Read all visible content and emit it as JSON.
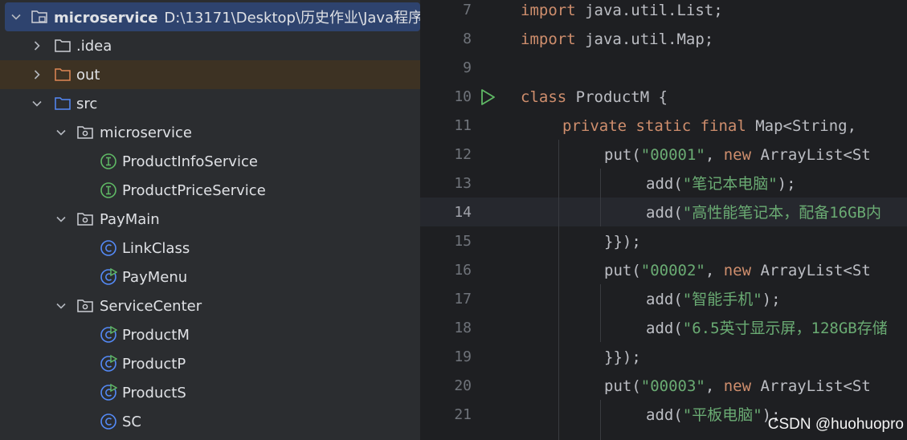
{
  "project_tree": {
    "root": {
      "name": "microservice",
      "path": "D:\\13171\\Desktop\\历史作业\\Java程序设"
    },
    "items": [
      {
        "label": ".idea",
        "type": "folder"
      },
      {
        "label": "out",
        "type": "folder-orange"
      },
      {
        "label": "src",
        "type": "folder-src"
      },
      {
        "label": "microservice",
        "type": "package"
      },
      {
        "label": "ProductInfoService",
        "type": "interface"
      },
      {
        "label": "ProductPriceService",
        "type": "interface"
      },
      {
        "label": "PayMain",
        "type": "package"
      },
      {
        "label": "LinkClass",
        "type": "class"
      },
      {
        "label": "PayMenu",
        "type": "runnable-class"
      },
      {
        "label": "ServiceCenter",
        "type": "package"
      },
      {
        "label": "ProductM",
        "type": "runnable-class"
      },
      {
        "label": "ProductP",
        "type": "runnable-class"
      },
      {
        "label": "ProductS",
        "type": "runnable-class"
      },
      {
        "label": "SC",
        "type": "class"
      }
    ]
  },
  "editor": {
    "line_numbers": [
      "7",
      "8",
      "9",
      "10",
      "11",
      "12",
      "13",
      "14",
      "15",
      "16",
      "17",
      "18",
      "19",
      "20",
      "21"
    ],
    "active_line": "14",
    "lines": {
      "l7": {
        "kw": "import",
        "rest": " java.util.List;"
      },
      "l8": {
        "kw": "import",
        "rest": " java.util.Map;"
      },
      "l10": {
        "kw": "class",
        "rest": " ProductM {"
      },
      "l11": {
        "kw": "private static final",
        "rest": " Map<String,"
      },
      "l12": {
        "a": "put(",
        "s": "\"00001\"",
        "b": ", ",
        "kw": "new",
        "c": " ArrayList<St"
      },
      "l13": {
        "a": "add(",
        "s": "\"笔记本电脑\"",
        "b": ");"
      },
      "l14": {
        "a": "add(",
        "s": "\"高性能笔记本，配备16GB内"
      },
      "l15": {
        "a": "}});"
      },
      "l16": {
        "a": "put(",
        "s": "\"00002\"",
        "b": ", ",
        "kw": "new",
        "c": " ArrayList<St"
      },
      "l17": {
        "a": "add(",
        "s": "\"智能手机\"",
        "b": ");"
      },
      "l18": {
        "a": "add(",
        "s": "\"6.5英寸显示屏，128GB存储"
      },
      "l19": {
        "a": "}});"
      },
      "l20": {
        "a": "put(",
        "s": "\"00003\"",
        "b": ", ",
        "kw": "new",
        "c": " ArrayList<St"
      },
      "l21": {
        "a": "add(",
        "s": "\"平板电脑\"",
        "b": ");"
      }
    }
  },
  "watermark": "CSDN @huohuopro"
}
